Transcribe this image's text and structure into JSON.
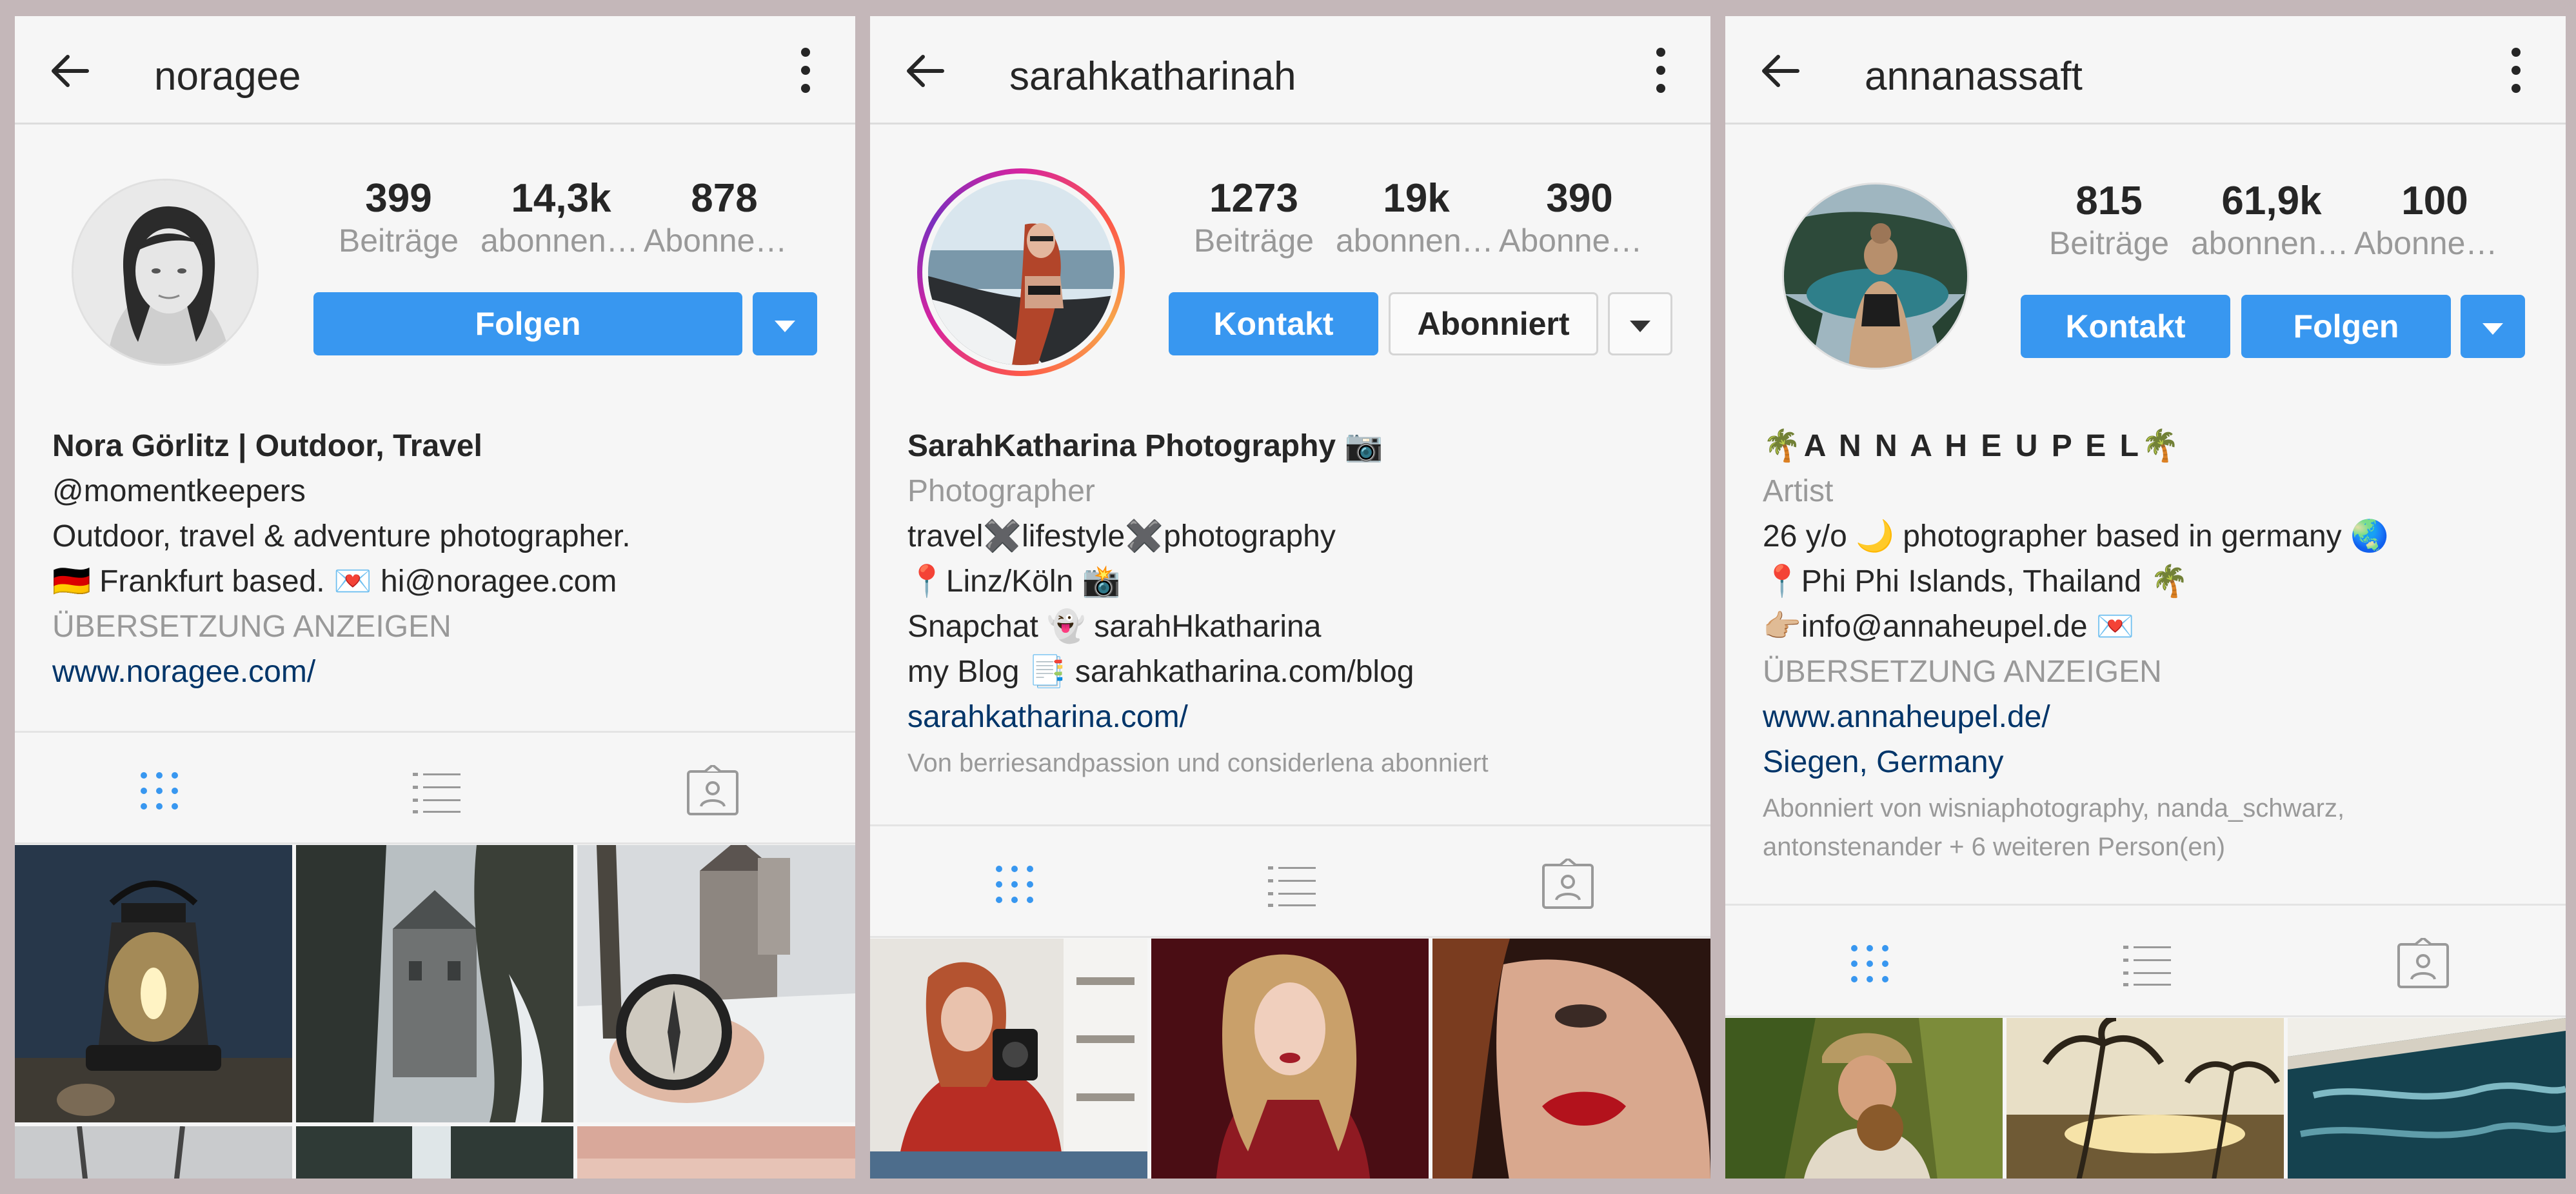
{
  "colors": {
    "accent": "#3897f0",
    "link": "#003569",
    "muted": "#999999",
    "background": "#c4b7b9"
  },
  "profiles": [
    {
      "username": "noragee",
      "stats": [
        {
          "value": "399",
          "label": "Beiträge"
        },
        {
          "value": "14,3k",
          "label": "abonnent..."
        },
        {
          "value": "878",
          "label": "Abonnem..."
        }
      ],
      "buttons": {
        "primary": "Folgen"
      },
      "bio": {
        "name": "Nora Görlitz | Outdoor, Travel",
        "lines": [
          "@momentkeepers",
          "Outdoor, travel & adventure photographer.",
          "🇩🇪 Frankfurt based. 💌 hi@noragee.com"
        ],
        "translate": "ÜBERSETZUNG ANZEIGEN",
        "link": "www.noragee.com/"
      }
    },
    {
      "username": "sarahkatharinah",
      "stats": [
        {
          "value": "1273",
          "label": "Beiträge"
        },
        {
          "value": "19k",
          "label": "abonnent..."
        },
        {
          "value": "390",
          "label": "Abonnem..."
        }
      ],
      "buttons": {
        "primary": "Kontakt",
        "secondary": "Abonniert"
      },
      "bio": {
        "name": "SarahKatharina Photography 📷",
        "category": "Photographer",
        "lines": [
          "travel✖️lifestyle✖️photography",
          "📍Linz/Köln 📸",
          "Snapchat 👻 sarahHkatharina",
          "my Blog 📑 sarahkatharina.com/blog"
        ],
        "link": "sarahkatharina.com/",
        "followed_by": "Von berriesandpassion und considerlena abonniert"
      }
    },
    {
      "username": "annanassaft",
      "stats": [
        {
          "value": "815",
          "label": "Beiträge"
        },
        {
          "value": "61,9k",
          "label": "abonnent..."
        },
        {
          "value": "100",
          "label": "Abonnem..."
        }
      ],
      "buttons": {
        "primary": "Kontakt",
        "secondary": "Folgen"
      },
      "bio": {
        "name": "🌴A N N A   H E U P E L🌴",
        "category": "Artist",
        "lines": [
          "26 y/o 🌙 photographer based in germany 🌏",
          "📍Phi Phi Islands, Thailand 🌴",
          "👉🏼info@annaheupel.de 💌"
        ],
        "translate": "ÜBERSETZUNG ANZEIGEN",
        "link": "www.annaheupel.de/",
        "location": "Siegen, Germany",
        "followed_by_1": "Abonniert von wisniaphotography, nanda_schwarz,",
        "followed_by_2": "antonstenander + 6 weiteren Person(en)"
      }
    }
  ]
}
